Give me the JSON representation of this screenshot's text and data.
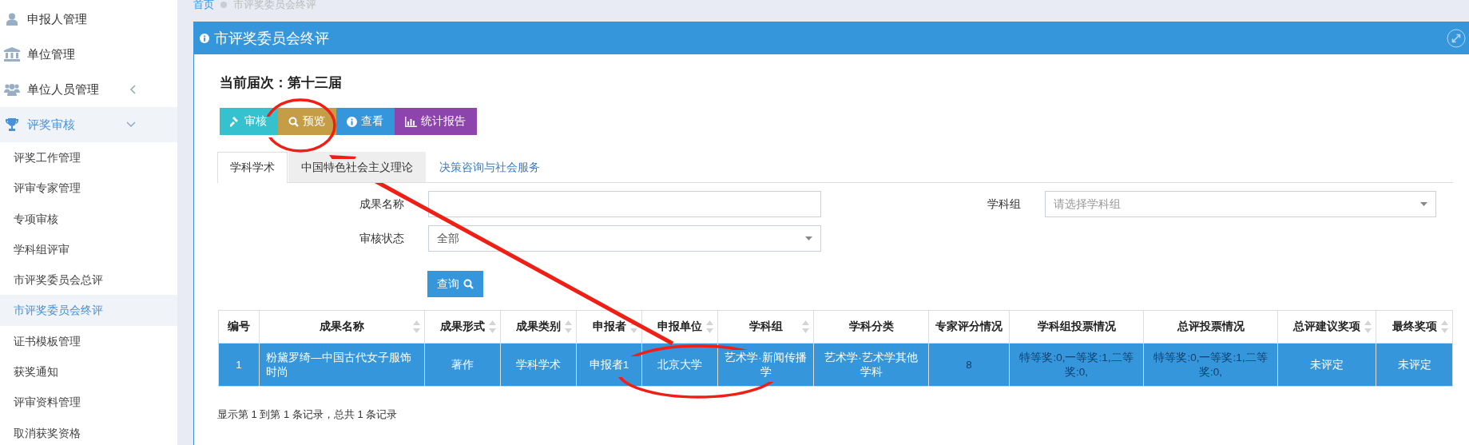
{
  "sidebar": {
    "items": [
      {
        "label": "申报人管理",
        "selected": false
      },
      {
        "label": "单位管理",
        "selected": false
      },
      {
        "label": "单位人员管理",
        "selected": false,
        "expanded": false
      },
      {
        "label": "评奖审核",
        "selected": true,
        "expanded": true,
        "children": [
          {
            "label": "评奖工作管理",
            "selected": false
          },
          {
            "label": "评审专家管理",
            "selected": false
          },
          {
            "label": "专项审核",
            "selected": false
          },
          {
            "label": "学科组评审",
            "selected": false
          },
          {
            "label": "市评奖委员会总评",
            "selected": false
          },
          {
            "label": "市评奖委员会终评",
            "selected": true
          },
          {
            "label": "证书模板管理",
            "selected": false
          },
          {
            "label": "获奖通知",
            "selected": false
          },
          {
            "label": "评审资料管理",
            "selected": false
          },
          {
            "label": "取消获奖资格",
            "selected": false
          }
        ]
      }
    ]
  },
  "breadcrumb": [
    "首页",
    "市评奖委员会终评"
  ],
  "panel": {
    "title": "市评奖委员会终评",
    "session": "当前届次：第十三届",
    "toolbar": [
      {
        "label": "审核",
        "color": "#36c1cf"
      },
      {
        "label": "预览",
        "color": "#c59d46"
      },
      {
        "label": "查看",
        "color": "#3596db"
      },
      {
        "label": "统计报告",
        "color": "#8e44ad"
      }
    ],
    "tabs": [
      {
        "label": "学科学术",
        "selected": true,
        "hovered": false
      },
      {
        "label": "中国特色社会主义理论",
        "selected": false,
        "hovered": true
      },
      {
        "label": "决策咨询与社会服务",
        "selected": false,
        "hovered": false
      }
    ],
    "filters": [
      {
        "label": "成果名称",
        "kind": "text"
      },
      {
        "label": "学科组",
        "kind": "select",
        "placeholder": "请选择学科组"
      },
      {
        "label": "审核状态",
        "kind": "select",
        "value": "全部"
      }
    ],
    "search_button": "查询",
    "table": {
      "columns": [
        {
          "label": "编号",
          "sortable": false
        },
        {
          "label": "成果名称",
          "sortable": true
        },
        {
          "label": "成果形式",
          "sortable": true
        },
        {
          "label": "成果类别",
          "sortable": true
        },
        {
          "label": "申报者",
          "sortable": true
        },
        {
          "label": "申报单位",
          "sortable": true
        },
        {
          "label": "学科组",
          "sortable": true
        },
        {
          "label": "学科分类",
          "sortable": false
        },
        {
          "label": "专家评分情况",
          "sortable": false
        },
        {
          "label": "学科组投票情况",
          "sortable": false
        },
        {
          "label": "总评投票情况",
          "sortable": false
        },
        {
          "label": "总评建议奖项",
          "sortable": true
        },
        {
          "label": "最终奖项",
          "sortable": true
        }
      ],
      "rows": [
        {
          "selected": true,
          "cells": [
            {
              "text": "1",
              "muted": false
            },
            {
              "text": "粉黛罗绮—中国古代女子服饰时尚",
              "muted": false
            },
            {
              "text": "著作",
              "muted": false
            },
            {
              "text": "学科学术",
              "muted": false
            },
            {
              "text": "申报者1",
              "muted": false
            },
            {
              "text": "北京大学",
              "muted": false
            },
            {
              "text": "艺术学·新闻传播学",
              "muted": false
            },
            {
              "text": "艺术学·艺术学其他学科",
              "muted": false
            },
            {
              "text": "8",
              "muted": true
            },
            {
              "text": "特等奖:0,一等奖:1,二等奖:0,",
              "muted": true
            },
            {
              "text": "特等奖:0,一等奖:1,二等奖:0,",
              "muted": true
            },
            {
              "text": "未评定",
              "muted": false
            },
            {
              "text": "未评定",
              "muted": false
            }
          ]
        }
      ]
    },
    "footer": "显示第 1 到第 1 条记录，总共 1 条记录"
  }
}
